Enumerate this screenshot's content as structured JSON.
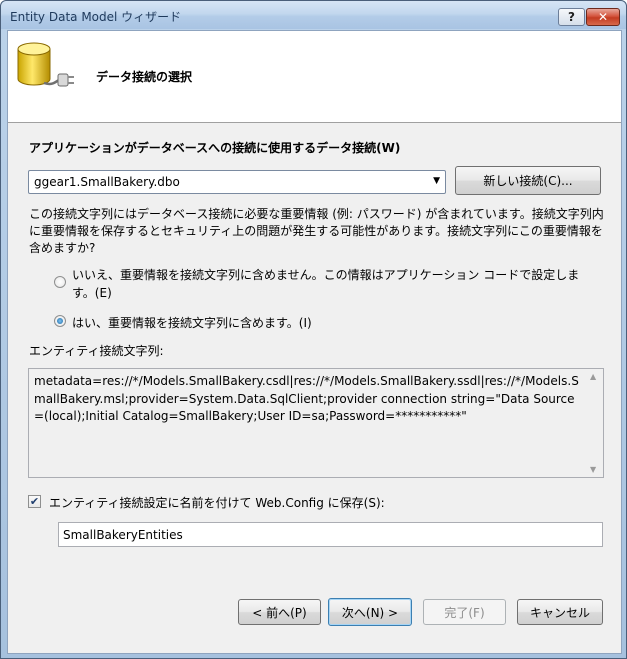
{
  "window": {
    "title": "Entity Data Model ウィザード",
    "help_label": "?",
    "close_label": "✕"
  },
  "header": {
    "title": "データ接続の選択",
    "icon": "database-plug-icon"
  },
  "connection": {
    "label": "アプリケーションがデータベースへの接続に使用するデータ接続(W)",
    "selected": "ggear1.SmallBakery.dbo",
    "new_button": "新しい接続(C)..."
  },
  "sensitive": {
    "description": "この接続文字列にはデータベース接続に必要な重要情報 (例: パスワード) が含まれています。接続文字列内に重要情報を保存するとセキュリティ上の問題が発生する可能性があります。接続文字列にこの重要情報を含めますか?",
    "option_no": "いいえ、重要情報を接続文字列に含めません。この情報はアプリケーション コードで設定します。(E)",
    "option_yes": "はい、重要情報を接続文字列に含めます。(I)",
    "selected": "yes"
  },
  "entity_connection": {
    "label": "エンティティ接続文字列:",
    "value": "metadata=res://*/Models.SmallBakery.csdl|res://*/Models.SmallBakery.ssdl|res://*/Models.SmallBakery.msl;provider=System.Data.SqlClient;provider connection string=\"Data Source=(local);Initial Catalog=SmallBakery;User ID=sa;Password=***********\""
  },
  "save": {
    "checked": true,
    "label": "エンティティ接続設定に名前を付けて Web.Config に保存(S):",
    "name_value": "SmallBakeryEntities"
  },
  "footer": {
    "back": "< 前へ(P)",
    "next": "次へ(N) >",
    "finish": "完了(F)",
    "cancel": "キャンセル"
  }
}
